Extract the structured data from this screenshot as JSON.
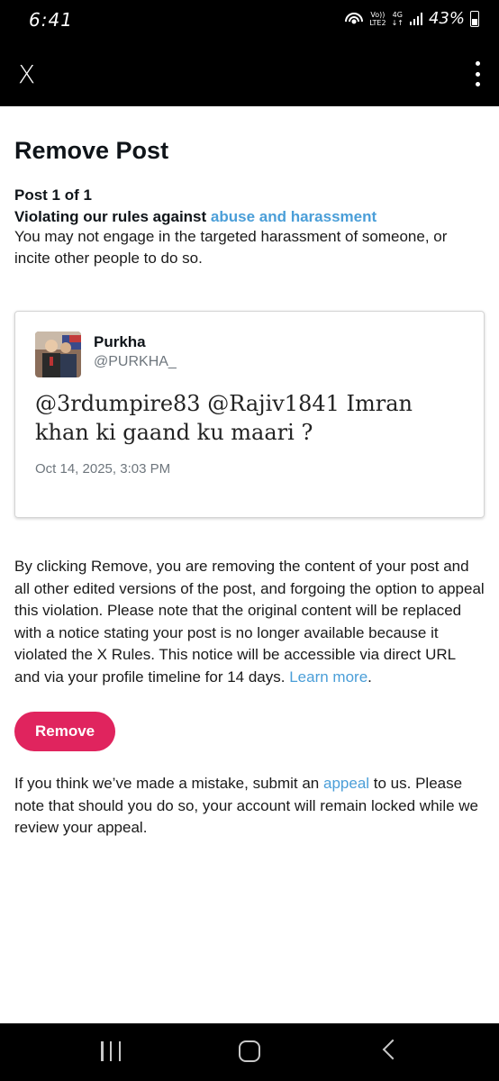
{
  "status_bar": {
    "time": "6:41",
    "network_top": "Vo))",
    "network_bottom": "LTE2",
    "data_type": "4G",
    "battery": "43%"
  },
  "app_bar": {
    "logo": "X"
  },
  "page": {
    "title": "Remove Post",
    "post_count": "Post 1 of 1",
    "rule_prefix": "Violating our rules against ",
    "rule_link": "abuse and harassment",
    "rule_description": "You may not engage in the targeted harassment of someone, or incite other people to do so."
  },
  "tweet": {
    "name": "Purkha",
    "handle": "@PURKHA_",
    "text": "@3rdumpire83 @Rajiv1841 Imran khan ki gaand ku maari ?",
    "timestamp": "Oct 14, 2025, 3:03 PM"
  },
  "notice": {
    "text": "By clicking Remove, you are removing the content of your post and all other edited versions of the post, and forgoing the option to appeal this violation. Please note that the original content will be replaced with a notice stating your post is no longer available because it violated the X Rules. This notice will be accessible via direct URL and via your profile timeline for 14 days. ",
    "link": "Learn more",
    "suffix": "."
  },
  "remove_button": {
    "label": "Remove",
    "color": "#e0245e"
  },
  "appeal": {
    "prefix": "If you think we’ve made a mistake, submit an ",
    "link": "appeal",
    "suffix": " to us. Please note that should you do so, your account will remain locked while we review your appeal."
  },
  "colors": {
    "link": "#4a9ed8",
    "bar_background": "#000000"
  },
  "icons": {
    "more": "more-vertical-icon",
    "nav_recent": "recent-apps-icon",
    "nav_home": "home-icon",
    "nav_back": "back-icon"
  }
}
